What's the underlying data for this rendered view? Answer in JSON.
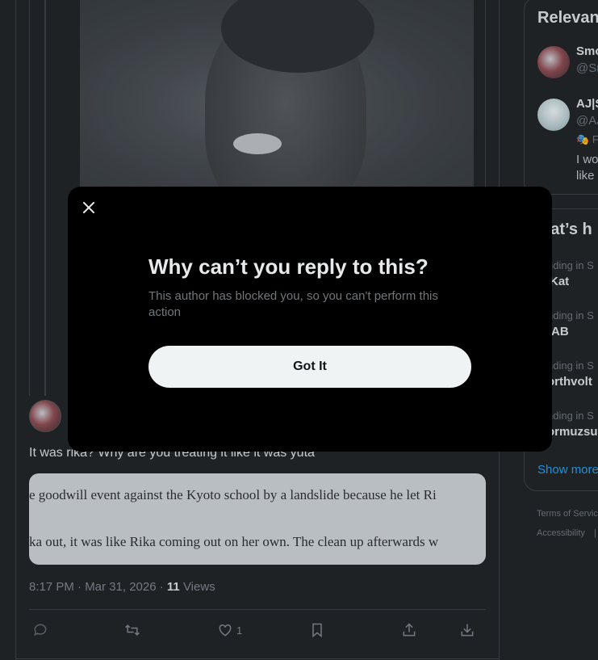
{
  "tweet": {
    "text": "It was rika? Why are you treating it like it was yuta",
    "quote_line1": "e goodwill event against the Kyoto school by a landslide because he let Ri",
    "quote_line2": "ka out, it was like Rika coming out on her own. The clean up afterwards w",
    "time": "8:17 PM · Mar 31, 2026 · ",
    "views_count": "11",
    "views_label": " Views",
    "like_count": "1"
  },
  "sidebar": {
    "relevant_title": "Relevan",
    "people": [
      {
        "name": "Smo",
        "handle": "@Sr"
      },
      {
        "name": "AJ|S",
        "handle": "@AJ",
        "badge": "F",
        "bio1": "I wo",
        "bio2": "like"
      }
    ],
    "trends_title": "hat’s h",
    "trends": [
      {
        "context": "nding in S",
        "name": "tKat"
      },
      {
        "context": "nding in S",
        "name": "AB"
      },
      {
        "context": "nding in S",
        "name": "orthvolt"
      },
      {
        "context": "nding in S",
        "name": "ormuzsur"
      }
    ],
    "show_more": "Show more",
    "footer": {
      "terms": "Terms of Servic",
      "accessibility": "Accessibility",
      "sep": "|"
    }
  },
  "modal": {
    "title": "Why can’t you reply to this?",
    "body": "This author has blocked you, so you can't perform this action",
    "button_label": "Got It"
  }
}
